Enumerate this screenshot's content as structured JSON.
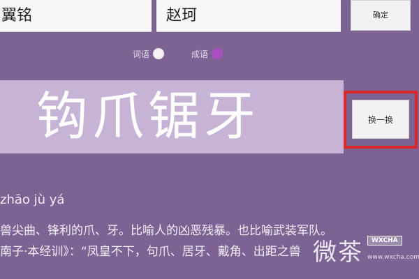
{
  "inputs": {
    "player_one": "翼铭",
    "player_two": "赵珂"
  },
  "buttons": {
    "confirm": "确定",
    "switch": "换一换"
  },
  "mode_options": [
    {
      "label": "词语",
      "dot_color": "#f6f3f6"
    },
    {
      "label": "成语",
      "dot_color": "#a94fc0"
    }
  ],
  "current_word": "钩爪锯牙",
  "pinyin": "zhāo jù yá",
  "definition": "兽尖曲、锋利的爪、牙。比喻人的凶恶残暴。也比喻武装军队。",
  "source": "南子·本经训》：“凤皇不下，句爪、居牙、戴角、出距之兽",
  "colors": {
    "background": "#7d6394",
    "word_panel": "#c6b3d6",
    "highlight_frame": "#d9272b"
  },
  "watermark": {
    "chinese": "微茶",
    "badge": "WXCHA",
    "url": "www.wxcha.com"
  }
}
